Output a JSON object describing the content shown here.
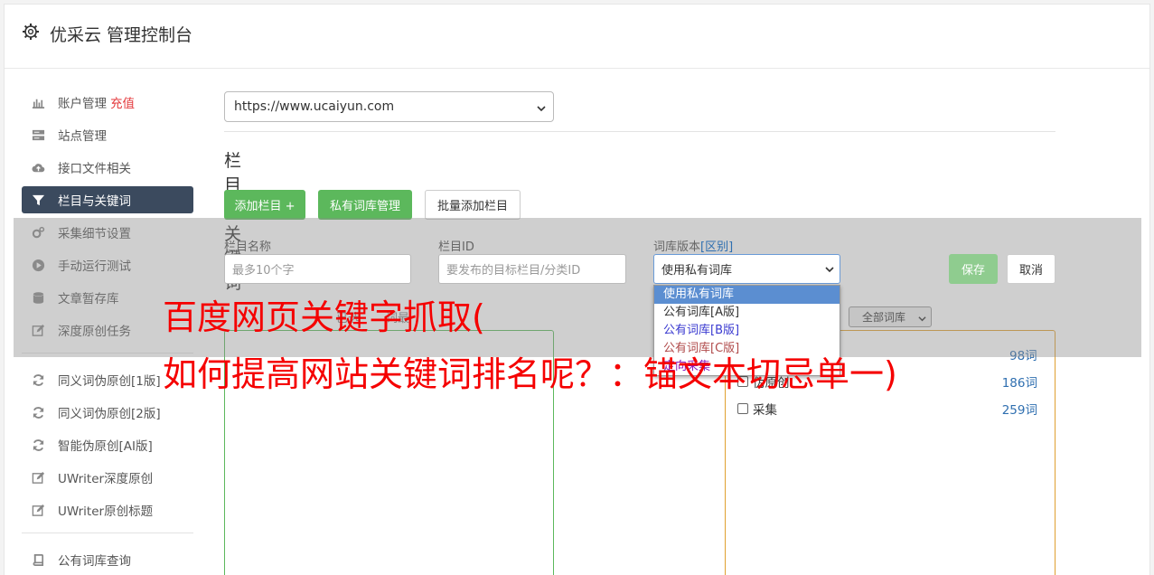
{
  "header": {
    "title": "优采云 管理控制台"
  },
  "sidebar": {
    "group1": [
      {
        "label": "账户管理",
        "badge": "充值",
        "icon": "bar-chart-icon"
      },
      {
        "label": "站点管理",
        "icon": "server-icon"
      },
      {
        "label": "接口文件相关",
        "icon": "cloud-upload-icon"
      },
      {
        "label": "栏目与关键词",
        "icon": "filter-icon",
        "active": true
      },
      {
        "label": "采集细节设置",
        "icon": "gears-icon"
      },
      {
        "label": "手动运行测试",
        "icon": "play-circle-icon"
      },
      {
        "label": "文章暂存库",
        "icon": "database-icon"
      },
      {
        "label": "深度原创任务",
        "icon": "edit-icon"
      }
    ],
    "group2": [
      {
        "label": "同义词伪原创[1版]",
        "icon": "refresh-icon"
      },
      {
        "label": "同义词伪原创[2版]",
        "icon": "refresh-icon"
      },
      {
        "label": "智能伪原创[AI版]",
        "icon": "refresh-icon"
      },
      {
        "label": "UWriter深度原创",
        "icon": "edit-icon"
      },
      {
        "label": "UWriter原创标题",
        "icon": "edit-icon"
      }
    ],
    "group3": [
      {
        "label": "公有词库查询",
        "icon": "book-icon"
      }
    ]
  },
  "main": {
    "site_select": "https://www.ucaiyun.com",
    "section_title": "栏目与关键词",
    "buttons": {
      "add_column": "添加栏目 +",
      "private_lib": "私有词库管理",
      "batch_add": "批量添加栏目"
    }
  },
  "form": {
    "name_label": "栏目名称",
    "name_placeholder": "最多10个字",
    "id_label": "栏目ID",
    "id_placeholder": "要发布的目标栏目/分类ID",
    "lib_label": "词库版本",
    "lib_label_link": "[区别]",
    "lib_value": "使用私有词库",
    "lib_options": [
      "使用私有词库",
      "公有词库[A版]",
      "公有词库[B版]",
      "公有词库[C版]",
      "定向采集"
    ],
    "save": "保存",
    "cancel": "取消",
    "hint_fragment": "已选",
    "hint_fragment2": "词最"
  },
  "library": {
    "filter": "全部词库",
    "rows": [
      {
        "label": "伪原创",
        "count": "186词"
      },
      {
        "label": "采集",
        "count": "259词"
      }
    ],
    "top_count": "98词"
  },
  "watermark": {
    "line1": "百度网页关键字抓取(",
    "line2": "如何提高网站关键词排名呢？：锚文本切忌单一)"
  },
  "colors": {
    "accent_green": "#5cb85c",
    "active_nav": "#3b4a5e",
    "badge_red": "#e4393c",
    "watermark_red": "#f50000"
  }
}
